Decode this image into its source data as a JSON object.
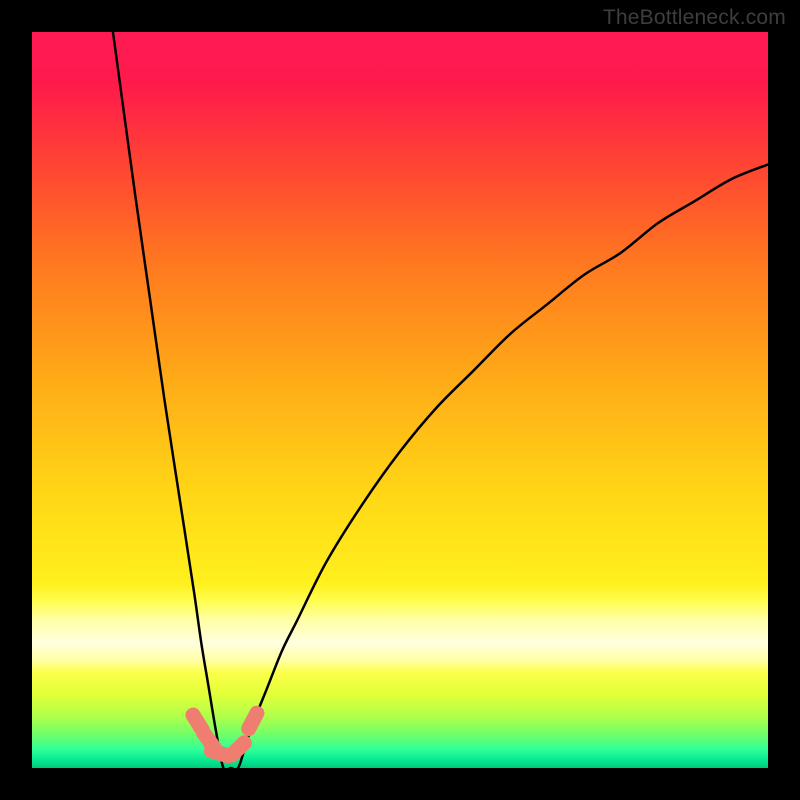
{
  "watermark": "TheBottleneck.com",
  "chart_data": {
    "type": "line",
    "title": "",
    "xlabel": "",
    "ylabel": "",
    "xlim": [
      0,
      100
    ],
    "ylim": [
      0,
      100
    ],
    "annotations": [],
    "curve": {
      "description": "V-shaped bottleneck curve; minimum near x≈26 at y≈0, left branch steep to top edge, right branch gentler reaching y≈82 at x=100",
      "x": [
        11,
        14,
        16,
        18,
        20,
        22,
        23,
        24,
        25,
        26,
        27,
        28,
        29,
        30,
        32,
        34,
        36,
        40,
        45,
        50,
        55,
        60,
        65,
        70,
        75,
        80,
        85,
        90,
        95,
        100
      ],
      "y": [
        100,
        78,
        64,
        50,
        37,
        24,
        17,
        11,
        5,
        0,
        0,
        0,
        3,
        6,
        11,
        16,
        20,
        28,
        36,
        43,
        49,
        54,
        59,
        63,
        67,
        70,
        74,
        77,
        80,
        82
      ]
    },
    "markers": {
      "x": [
        22.5,
        24.0,
        25.5,
        28.0,
        30.0
      ],
      "y": [
        6.2,
        3.8,
        2.0,
        2.6,
        6.4
      ]
    },
    "green_band": {
      "y_bottom": 0.0,
      "y_top": 4.0
    },
    "yellow_band_highlight": {
      "y_bottom": 13.0,
      "y_top": 23.0
    },
    "gradient_stops": [
      {
        "pos": 0.0,
        "color": "#ff1a54"
      },
      {
        "pos": 0.07,
        "color": "#ff1a4c"
      },
      {
        "pos": 0.18,
        "color": "#ff4433"
      },
      {
        "pos": 0.32,
        "color": "#ff7a1f"
      },
      {
        "pos": 0.48,
        "color": "#ffad17"
      },
      {
        "pos": 0.63,
        "color": "#ffd716"
      },
      {
        "pos": 0.75,
        "color": "#fff01e"
      },
      {
        "pos": 0.775,
        "color": "#fffe55"
      },
      {
        "pos": 0.8,
        "color": "#ffffa8"
      },
      {
        "pos": 0.83,
        "color": "#ffffe0"
      },
      {
        "pos": 0.855,
        "color": "#ffffa0"
      },
      {
        "pos": 0.87,
        "color": "#fbff4a"
      },
      {
        "pos": 0.9,
        "color": "#e2ff38"
      },
      {
        "pos": 0.93,
        "color": "#b0ff4a"
      },
      {
        "pos": 0.955,
        "color": "#6fff6a"
      },
      {
        "pos": 0.975,
        "color": "#2eff9a"
      },
      {
        "pos": 0.99,
        "color": "#05e890"
      },
      {
        "pos": 1.0,
        "color": "#00c97b"
      }
    ]
  }
}
